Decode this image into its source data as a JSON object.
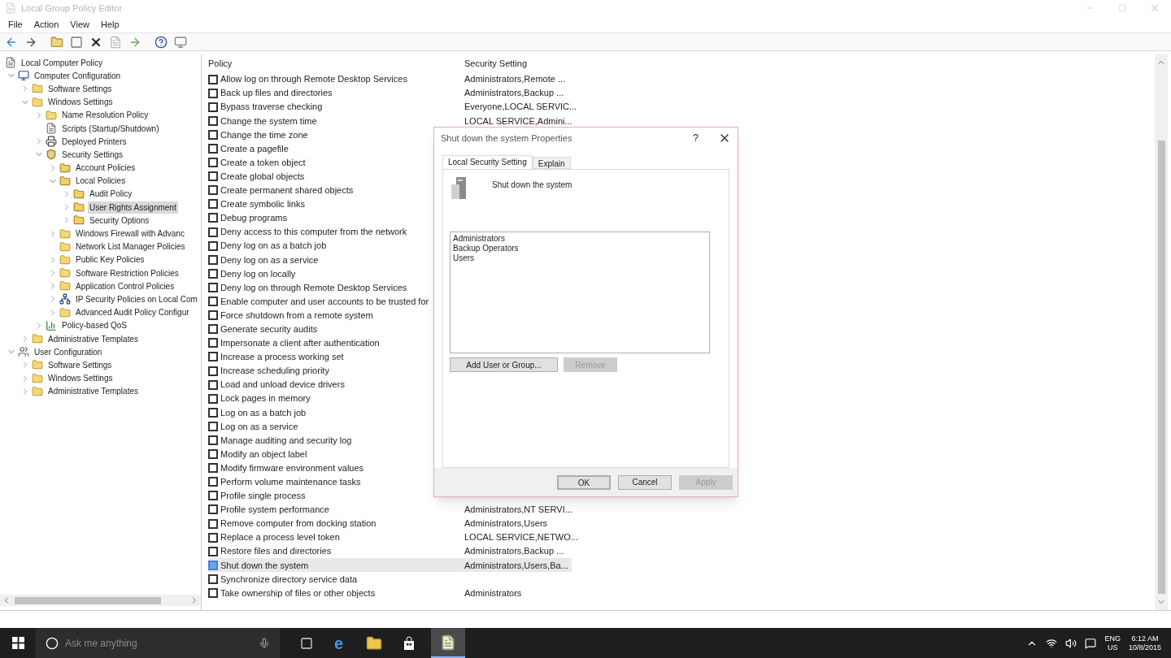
{
  "window": {
    "title": "Local Group Policy Editor"
  },
  "menu": [
    "File",
    "Action",
    "View",
    "Help"
  ],
  "tree": [
    {
      "label": "Local Computer Policy",
      "kind": "document",
      "selected": false,
      "children": [
        {
          "label": "Computer Configuration",
          "kind": "computer",
          "expandable": true,
          "expanded": true,
          "selected": false,
          "children": [
            {
              "label": "Software Settings",
              "kind": "folder",
              "expandable": true,
              "expanded": false,
              "selected": false
            },
            {
              "label": "Windows Settings",
              "kind": "folder",
              "expandable": true,
              "expanded": true,
              "selected": false,
              "children": [
                {
                  "label": "Name Resolution Policy",
                  "kind": "folder",
                  "expandable": true,
                  "expanded": false,
                  "selected": false
                },
                {
                  "label": "Scripts (Startup/Shutdown)",
                  "kind": "document",
                  "expandable": false,
                  "selected": false
                },
                {
                  "label": "Deployed Printers",
                  "kind": "printer",
                  "expandable": true,
                  "expanded": false,
                  "selected": false
                },
                {
                  "label": "Security Settings",
                  "kind": "shield",
                  "expandable": true,
                  "expanded": true,
                  "selected": false,
                  "children": [
                    {
                      "label": "Account Policies",
                      "kind": "secfolder",
                      "expandable": true,
                      "expanded": false,
                      "selected": false
                    },
                    {
                      "label": "Local Policies",
                      "kind": "secfolder",
                      "expandable": true,
                      "expanded": true,
                      "selected": false,
                      "children": [
                        {
                          "label": "Audit Policy",
                          "kind": "secfolder",
                          "expandable": true,
                          "expanded": false,
                          "selected": false
                        },
                        {
                          "label": "User Rights Assignment",
                          "kind": "secfolder",
                          "expandable": true,
                          "expanded": false,
                          "selected": true
                        },
                        {
                          "label": "Security Options",
                          "kind": "secfolder",
                          "expandable": true,
                          "expanded": false,
                          "selected": false
                        }
                      ]
                    },
                    {
                      "label": "Windows Firewall with Advanc",
                      "kind": "folder",
                      "expandable": true,
                      "expanded": false,
                      "selected": false
                    },
                    {
                      "label": "Network List Manager Policies",
                      "kind": "folder",
                      "expandable": false,
                      "selected": false
                    },
                    {
                      "label": "Public Key Policies",
                      "kind": "folder",
                      "expandable": true,
                      "expanded": false,
                      "selected": false
                    },
                    {
                      "label": "Software Restriction Policies",
                      "kind": "folder",
                      "expandable": true,
                      "expanded": false,
                      "selected": false
                    },
                    {
                      "label": "Application Control Policies",
                      "kind": "folder",
                      "expandable": true,
                      "expanded": false,
                      "selected": false
                    },
                    {
                      "label": "IP Security Policies on Local Com",
                      "kind": "network",
                      "expandable": true,
                      "expanded": false,
                      "selected": false
                    },
                    {
                      "label": "Advanced Audit Policy Configur",
                      "kind": "folder",
                      "expandable": true,
                      "expanded": false,
                      "selected": false
                    }
                  ]
                },
                {
                  "label": "Policy-based QoS",
                  "kind": "chart",
                  "expandable": true,
                  "expanded": false,
                  "selected": false
                }
              ]
            },
            {
              "label": "Administrative Templates",
              "kind": "folder",
              "expandable": true,
              "expanded": false,
              "selected": false
            }
          ]
        },
        {
          "label": "User Configuration",
          "kind": "user",
          "expandable": true,
          "expanded": true,
          "selected": false,
          "children": [
            {
              "label": "Software Settings",
              "kind": "folder",
              "expandable": true,
              "expanded": false,
              "selected": false
            },
            {
              "label": "Windows Settings",
              "kind": "folder",
              "expandable": true,
              "expanded": false,
              "selected": false
            },
            {
              "label": "Administrative Templates",
              "kind": "folder",
              "expandable": true,
              "expanded": false,
              "selected": false
            }
          ]
        }
      ]
    }
  ],
  "table": {
    "columns": [
      "Policy",
      "Security Setting"
    ],
    "rows": [
      {
        "policy": "Allow log on through Remote Desktop Services",
        "setting": "Administrators,Remote ...",
        "selected": false
      },
      {
        "policy": "Back up files and directories",
        "setting": "Administrators,Backup ...",
        "selected": false
      },
      {
        "policy": "Bypass traverse checking",
        "setting": "Everyone,LOCAL SERVIC...",
        "selected": false
      },
      {
        "policy": "Change the system time",
        "setting": "LOCAL SERVICE,Admini...",
        "selected": false
      },
      {
        "policy": "Change the time zone",
        "selected": false
      },
      {
        "policy": "Create a pagefile",
        "selected": false
      },
      {
        "policy": "Create a token object",
        "selected": false
      },
      {
        "policy": "Create global objects",
        "selected": false
      },
      {
        "policy": "Create permanent shared objects",
        "selected": false
      },
      {
        "policy": "Create symbolic links",
        "selected": false
      },
      {
        "policy": "Debug programs",
        "selected": false
      },
      {
        "policy": "Deny access to this computer from the network",
        "selected": false
      },
      {
        "policy": "Deny log on as a batch job",
        "selected": false
      },
      {
        "policy": "Deny log on as a service",
        "selected": false
      },
      {
        "policy": "Deny log on locally",
        "selected": false
      },
      {
        "policy": "Deny log on through Remote Desktop Services",
        "selected": false
      },
      {
        "policy": "Enable computer and user accounts to be trusted for",
        "selected": false
      },
      {
        "policy": "Force shutdown from a remote system",
        "selected": false
      },
      {
        "policy": "Generate security audits",
        "selected": false
      },
      {
        "policy": "Impersonate a client after authentication",
        "selected": false
      },
      {
        "policy": "Increase a process working set",
        "selected": false
      },
      {
        "policy": "Increase scheduling priority",
        "selected": false
      },
      {
        "policy": "Load and unload device drivers",
        "selected": false
      },
      {
        "policy": "Lock pages in memory",
        "selected": false
      },
      {
        "policy": "Log on as a batch job",
        "selected": false
      },
      {
        "policy": "Log on as a service",
        "selected": false
      },
      {
        "policy": "Manage auditing and security log",
        "selected": false
      },
      {
        "policy": "Modify an object label",
        "selected": false
      },
      {
        "policy": "Modify firmware environment values",
        "selected": false
      },
      {
        "policy": "Perform volume maintenance tasks",
        "selected": false
      },
      {
        "policy": "Profile single process",
        "selected": false
      },
      {
        "policy": "Profile system performance",
        "setting": "Administrators,NT SERVI...",
        "selected": false
      },
      {
        "policy": "Remove computer from docking station",
        "setting": "Administrators,Users",
        "selected": false
      },
      {
        "policy": "Replace a process level token",
        "setting": "LOCAL SERVICE,NETWO...",
        "selected": false
      },
      {
        "policy": "Restore files and directories",
        "setting": "Administrators,Backup ...",
        "selected": false
      },
      {
        "policy": "Shut down the system",
        "setting": "Administrators,Users,Ba...",
        "selected": true
      },
      {
        "policy": "Synchronize directory service data",
        "selected": false
      },
      {
        "policy": "Take ownership of files or other objects",
        "setting": "Administrators",
        "selected": false
      }
    ]
  },
  "dialog": {
    "title": "Shut down the system Properties",
    "help": "?",
    "tabs": [
      {
        "label": "Local Security Setting",
        "selected": true
      },
      {
        "label": "Explain",
        "selected": false
      }
    ],
    "policy_name": "Shut down the system",
    "members": [
      "Administrators",
      "Backup Operators",
      "Users"
    ],
    "list_buttons": [
      {
        "label": "Add User or Group...",
        "disabled": false
      },
      {
        "label": "Remove",
        "disabled": true
      }
    ],
    "buttons": [
      {
        "label": "OK",
        "disabled": false,
        "default": true
      },
      {
        "label": "Cancel",
        "disabled": false,
        "default": false
      },
      {
        "label": "Apply",
        "disabled": true,
        "default": false
      }
    ]
  },
  "taskbar": {
    "search_placeholder": "Ask me anything",
    "browser_glyph": "e",
    "language": "ENG",
    "region": "US",
    "time": "6:12 AM",
    "date": "10/8/2015"
  }
}
